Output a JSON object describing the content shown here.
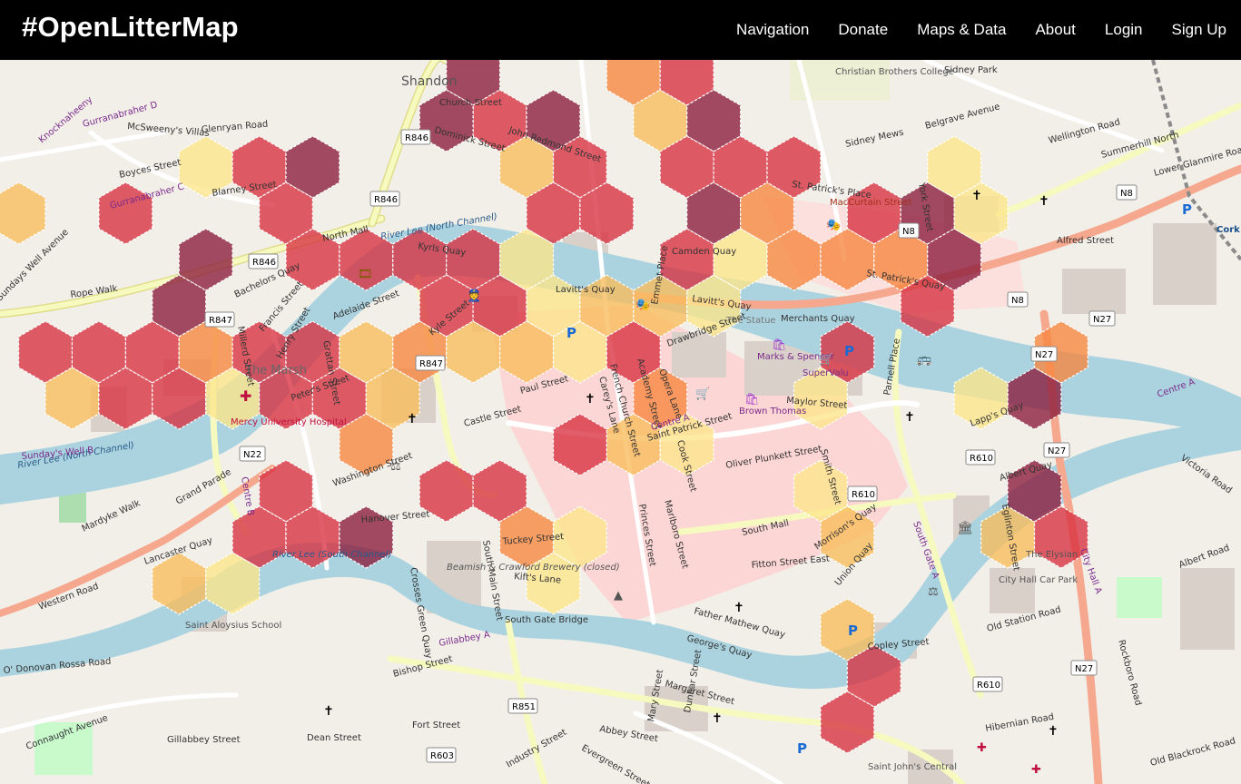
{
  "navbar": {
    "brand": "#OpenLitterMap",
    "links": [
      "Navigation",
      "Donate",
      "Maps & Data",
      "About",
      "Login",
      "Sign Up"
    ]
  },
  "map": {
    "colors": {
      "land": "#f2efe9",
      "river": "#aad3df",
      "pedestrian": "#fcd6d5",
      "major_road": "#f7fabf",
      "trunk_road": "#f6a88f",
      "dark_red": "#8b1a3a",
      "red": "#d7303f",
      "orange": "#f7853d",
      "light_orange": "#f9bd5a",
      "yellow": "#fde58a"
    },
    "labels": {
      "district_shandon": "Shandon",
      "district_the_marsh": "The Marsh",
      "church_street": "Church Street",
      "dominick_street": "Dominick Street",
      "john_redmond_street": "John Redmond Street",
      "north_mall": "North Mall",
      "kyrls_quay": "Kyrls Quay",
      "river_lee_north": "River Lee (North Channel)",
      "river_lee_south": "River Lee (South Channel)",
      "bachelors_quay": "Bachelors Quay",
      "adelaide_street": "Adelaide Street",
      "kyle_street": "Kyle Street",
      "lavitts_quay": "Lavitt's Quay",
      "camden_quay": "Camden Quay",
      "maccurtain_street": "MacCurtain Street",
      "st_patricks_quay": "St. Patrick's Quay",
      "alfred_street": "Alfred Street",
      "lower_glanmire_road": "Lower Glanmire Road",
      "summerhill_north": "Summerhill North",
      "wellington_road": "Wellington Road",
      "belgrave_avenue": "Belgrave Avenue",
      "sidney_park": "Sidney Park",
      "sidney_mews": "Sidney Mews",
      "christian_brothers_college": "Christian Brothers College",
      "st_patricks_place": "St. Patrick's Place",
      "york_street": "York Street",
      "parnell_place": "Parnell Place",
      "merchants_quay": "Merchants Quay",
      "saint_patrick_street": "Saint Patrick Street",
      "maylor_street": "Maylor Street",
      "marks_spencer": "Marks & Spencer",
      "supervalu": "SuperValu",
      "brown_thomas": "Brown Thomas",
      "the_statue": "The Statue",
      "oliver_plunkett_street": "Oliver Plunkett Street",
      "south_mall": "South Mall",
      "grand_parade": "Grand Parade",
      "washington_street": "Washington Street",
      "mercy_hospital": "Mercy University Hospital",
      "sundays_well_b": "Sunday's Well B",
      "western_road": "Western Road",
      "mardyke_walk": "Mardyke Walk",
      "lancaster_quay": "Lancaster Quay",
      "hanover_street": "Hanover Street",
      "kifts_lane": "Kift's Lane",
      "tuckey_street": "Tuckey Street",
      "south_main_street": "South Main Street",
      "beamish_crawford": "Beamish & Crawford Brewery (closed)",
      "crosses_green_quay": "Crosses Green Quay",
      "saint_aloysius_school": "Saint Aloysius School",
      "south_gate_bridge": "South Gate Bridge",
      "gillabbey_a": "Gillabbey A",
      "bishop_street": "Bishop Street",
      "georges_quay": "George's Quay",
      "father_mathew_quay": "Father Mathew Quay",
      "copley_street": "Copley Street",
      "union_quay": "Union Quay",
      "morrisons_quay": "Morrison's Quay",
      "fitton_street_east": "Fitton Street East",
      "albert_quay": "Albert Quay",
      "albert_road": "Albert Road",
      "victoria_road": "Victoria Road",
      "the_elysian": "The Elysian",
      "old_station_road": "Old Station Road",
      "city_hall_car_park": "City Hall Car Park",
      "hibernian_road": "Hibernian Road",
      "old_blackrock_road": "Old Blackrock Road",
      "rockboro_road": "Rockboro Road",
      "saint_johns_central": "Saint John's Central",
      "evergreen_street": "Evergreen Street",
      "abbey_street": "Abbey Street",
      "dunbar_street": "Dunbar Street",
      "mary_street": "Mary Street",
      "margaret_street": "Margaret Street",
      "industry_street": "Industry Street",
      "fort_street": "Fort Street",
      "dean_street": "Dean Street",
      "connaught_avenue": "Connaught Avenue",
      "gillabbey_street": "Gillabbey Street",
      "odonovan_rossa_road": "O' Donovan Rossa Road",
      "boyces_street": "Boyces Street",
      "blarney_street": "Blarney Street",
      "glenryan_road": "Glenryan Road",
      "mcsweenys_villas": "McSweeny's Villas",
      "gurranabraher_c": "Gurranabraher C",
      "gurranabraher_d": "Gurranabraher D",
      "knocknaheeny": "Knocknaheeny",
      "rope_walk": "Rope Walk",
      "sundays_well_avenue": "Sundays Well Avenue",
      "peters_street": "Peter's Street",
      "grattan_street": "Grattan Street",
      "henry_street": "Henry Street",
      "francis_street": "Francis Street",
      "millerd_street": "Millerd Street",
      "paul_street": "Paul Street",
      "castle_street": "Castle Street",
      "drawbridge_street": "Drawbridge Street",
      "emmet_place": "Emmet Place",
      "opera_lane": "Opera Lane",
      "academy_street": "Academy Street",
      "french_church_street": "French Church Street",
      "careys_lane": "Carey's Lane",
      "cook_street": "Cook Street",
      "marlboro_street": "Marlboro Street",
      "princes_street": "Princes Street",
      "smith_street": "Smith Street",
      "centre_a": "Centre A",
      "centre_b": "Centre B",
      "south_gate_a": "South Gate A",
      "city_hall_a": "City Hall A",
      "centre_a2": "Centre A",
      "lapps_quay": "Lapp's Quay",
      "egmont_place": "Eglinton Street",
      "road_r846": "R846",
      "road_r846b": "R846",
      "road_r847": "R847",
      "road_r847b": "R847",
      "road_n8": "N8",
      "road_n8b": "N8",
      "road_n8c": "N8",
      "road_n22": "N22",
      "road_n27": "N27",
      "road_n27b": "N27",
      "road_n27c": "N27",
      "road_n27d": "N27",
      "road_r610": "R610",
      "road_r610b": "R610",
      "road_r610c": "R610",
      "road_r851": "R851",
      "road_r603": "R603",
      "cork_station": "Cork"
    },
    "hexbins": [
      {
        "level": "light_orange",
        "col": -1,
        "row": 3
      },
      {
        "level": "red",
        "col": 1,
        "row": 3
      },
      {
        "level": "yellow",
        "col": 3,
        "row": 2
      },
      {
        "level": "red",
        "col": 4,
        "row": 2
      },
      {
        "level": "dark_red",
        "col": 5,
        "row": 2
      },
      {
        "level": "red",
        "col": 4,
        "row": 3
      },
      {
        "level": "dark_red",
        "col": 3,
        "row": 4
      },
      {
        "level": "red",
        "col": 5,
        "row": 4
      },
      {
        "level": "red",
        "col": 6,
        "row": 4
      },
      {
        "level": "red",
        "col": 7,
        "row": 4
      },
      {
        "level": "red",
        "col": 8,
        "row": 4
      },
      {
        "level": "dark_red",
        "col": 2,
        "row": 5
      },
      {
        "level": "red",
        "col": 2,
        "row": 6
      },
      {
        "level": "red",
        "col": 1,
        "row": 6
      },
      {
        "level": "red",
        "col": 0,
        "row": 6
      },
      {
        "level": "light_orange",
        "col": 0,
        "row": 7
      },
      {
        "level": "red",
        "col": 1,
        "row": 7
      },
      {
        "level": "red",
        "col": 2,
        "row": 7
      },
      {
        "level": "orange",
        "col": 3,
        "row": 6
      },
      {
        "level": "yellow",
        "col": 3,
        "row": 7
      },
      {
        "level": "red",
        "col": 4,
        "row": 6
      },
      {
        "level": "red",
        "col": 4,
        "row": 7
      },
      {
        "level": "red",
        "col": 5,
        "row": 6
      },
      {
        "level": "red",
        "col": 5,
        "row": 7
      },
      {
        "level": "light_orange",
        "col": 6,
        "row": 6
      },
      {
        "level": "light_orange",
        "col": 6,
        "row": 7
      },
      {
        "level": "red",
        "col": 7,
        "row": 5
      },
      {
        "level": "red",
        "col": 8,
        "row": 5
      },
      {
        "level": "orange",
        "col": 7,
        "row": 6
      },
      {
        "level": "light_orange",
        "col": 8,
        "row": 6
      },
      {
        "level": "orange",
        "col": 6,
        "row": 8
      },
      {
        "level": "red",
        "col": 4,
        "row": 9
      },
      {
        "level": "red",
        "col": 4,
        "row": 10
      },
      {
        "level": "red",
        "col": 5,
        "row": 10
      },
      {
        "level": "dark_red",
        "col": 6,
        "row": 10
      },
      {
        "level": "red",
        "col": 7,
        "row": 9
      },
      {
        "level": "red",
        "col": 8,
        "row": 9
      },
      {
        "level": "light_orange",
        "col": 2,
        "row": 11
      },
      {
        "level": "yellow",
        "col": 3,
        "row": 11
      },
      {
        "level": "red",
        "col": 9,
        "row": -1
      },
      {
        "level": "dark_red",
        "col": 8,
        "row": 0
      },
      {
        "level": "red",
        "col": 8,
        "row": 1
      },
      {
        "level": "dark_red",
        "col": 7,
        "row": 1
      },
      {
        "level": "dark_red",
        "col": 9,
        "row": 1
      },
      {
        "level": "light_orange",
        "col": 9,
        "row": 2
      },
      {
        "level": "red",
        "col": 10,
        "row": 2
      },
      {
        "level": "red",
        "col": 9,
        "row": 3
      },
      {
        "level": "red",
        "col": 10,
        "row": 3
      },
      {
        "level": "yellow",
        "col": 9,
        "row": 4
      },
      {
        "level": "yellow",
        "col": 9,
        "row": 5
      },
      {
        "level": "light_orange",
        "col": 9,
        "row": 6
      },
      {
        "level": "yellow",
        "col": 10,
        "row": 6
      },
      {
        "level": "light_orange",
        "col": 10,
        "row": 5
      },
      {
        "level": "light_orange",
        "col": 11,
        "row": 5
      },
      {
        "level": "red",
        "col": 11,
        "row": 6
      },
      {
        "level": "orange",
        "col": 11,
        "row": 7
      },
      {
        "level": "light_orange",
        "col": 11,
        "row": 8
      },
      {
        "level": "red",
        "col": 10,
        "row": 8
      },
      {
        "level": "orange",
        "col": 9,
        "row": 10
      },
      {
        "level": "yellow",
        "col": 9,
        "row": 11
      },
      {
        "level": "yellow",
        "col": 10,
        "row": 10
      },
      {
        "level": "light_orange",
        "col": 11,
        "row": 1
      },
      {
        "level": "orange",
        "col": 11,
        "row": 0
      },
      {
        "level": "red",
        "col": 12,
        "row": 0
      },
      {
        "level": "dark_red",
        "col": 12,
        "row": 1
      },
      {
        "level": "red",
        "col": 12,
        "row": 2
      },
      {
        "level": "dark_red",
        "col": 12,
        "row": 3
      },
      {
        "level": "red",
        "col": 12,
        "row": 4
      },
      {
        "level": "yellow",
        "col": 12,
        "row": 5
      },
      {
        "level": "orange",
        "col": 13,
        "row": 3
      },
      {
        "level": "yellow",
        "col": 13,
        "row": 4
      },
      {
        "level": "red",
        "col": 13,
        "row": 2
      },
      {
        "level": "red",
        "col": 14,
        "row": 2
      },
      {
        "level": "orange",
        "col": 14,
        "row": 4
      },
      {
        "level": "red",
        "col": 15,
        "row": 3
      },
      {
        "level": "orange",
        "col": 15,
        "row": 4
      },
      {
        "level": "red",
        "col": 16,
        "row": 5
      },
      {
        "level": "orange",
        "col": 16,
        "row": 4
      },
      {
        "level": "dark_red",
        "col": 16,
        "row": 3
      },
      {
        "level": "red",
        "col": 15,
        "row": 6
      },
      {
        "level": "dark_red",
        "col": 17,
        "row": 4
      },
      {
        "level": "yellow",
        "col": 17,
        "row": 3
      },
      {
        "level": "yellow",
        "col": 17,
        "row": 2
      },
      {
        "level": "dark_red",
        "col": 18,
        "row": 7
      },
      {
        "level": "yellow",
        "col": 17,
        "row": 7
      },
      {
        "level": "orange",
        "col": 19,
        "row": 6
      },
      {
        "level": "yellow",
        "col": 14,
        "row": 7
      },
      {
        "level": "yellow",
        "col": 14,
        "row": 9
      },
      {
        "level": "yellow",
        "col": 12,
        "row": 8
      },
      {
        "level": "light_orange",
        "col": 15,
        "row": 10
      },
      {
        "level": "light_orange",
        "col": 18,
        "row": 10
      },
      {
        "level": "dark_red",
        "col": 18,
        "row": 9
      },
      {
        "level": "red",
        "col": 19,
        "row": 10
      },
      {
        "level": "light_orange",
        "col": 15,
        "row": 12
      },
      {
        "level": "red",
        "col": 15,
        "row": 13
      },
      {
        "level": "red",
        "col": 15,
        "row": 14
      }
    ]
  }
}
